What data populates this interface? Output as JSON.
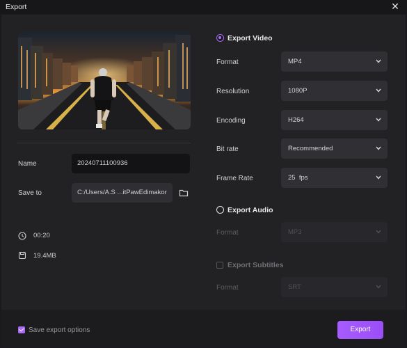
{
  "window": {
    "title": "Export"
  },
  "left": {
    "name_label": "Name",
    "name_value": "20240711100936",
    "save_label": "Save to",
    "save_value": "C:/Users/A.S ...itPawEdimakor",
    "duration": "00:20",
    "size": "19.4MB"
  },
  "video": {
    "title": "Export Video",
    "rows": [
      {
        "label": "Format",
        "value": "MP4"
      },
      {
        "label": "Resolution",
        "value": "1080P"
      },
      {
        "label": "Encoding",
        "value": "H264"
      },
      {
        "label": "Bit rate",
        "value": "Recommended"
      },
      {
        "label": "Frame Rate",
        "value": "25  fps"
      }
    ]
  },
  "audio": {
    "title": "Export Audio",
    "format_label": "Format",
    "format_value": "MP3"
  },
  "subtitles": {
    "title": "Export Subtitles",
    "format_label": "Format",
    "format_value": "SRT"
  },
  "footer": {
    "save_options_label": "Save export options",
    "export_label": "Export"
  },
  "colors": {
    "accent": "#a86af7",
    "background": "#222225",
    "field": "#2f2f34"
  }
}
